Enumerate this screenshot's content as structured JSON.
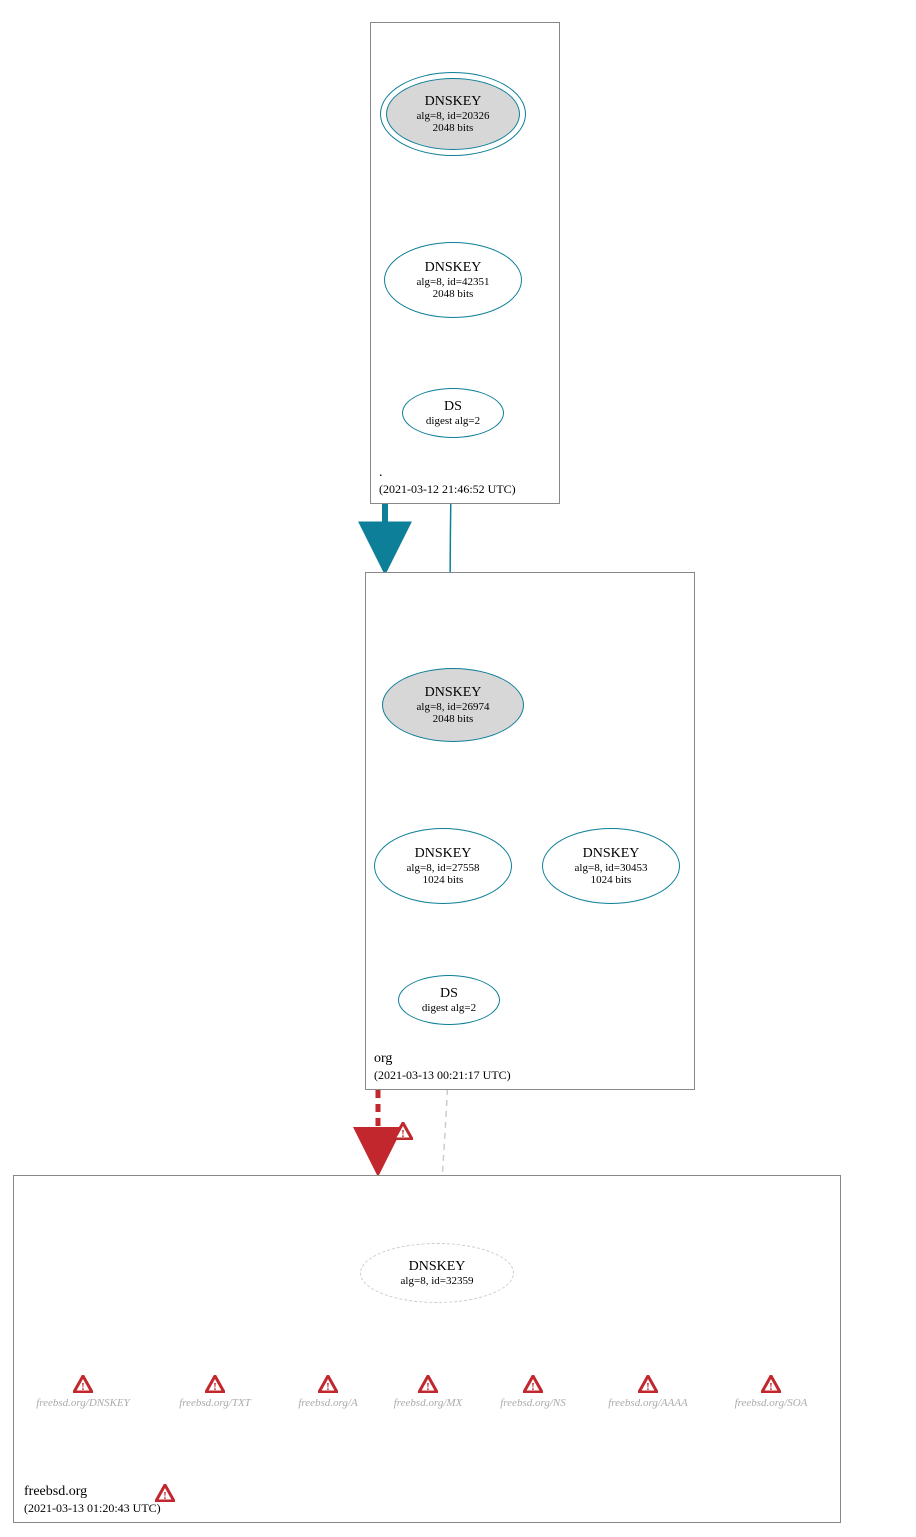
{
  "zones": {
    "root": {
      "label": ".",
      "timestamp": "(2021-03-12 21:46:52 UTC)"
    },
    "org": {
      "label": "org",
      "timestamp": "(2021-03-13 00:21:17 UTC)"
    },
    "freebsd": {
      "label": "freebsd.org",
      "timestamp": "(2021-03-13 01:20:43 UTC)"
    }
  },
  "nodes": {
    "root_ksk": {
      "title": "DNSKEY",
      "sub1": "alg=8, id=20326",
      "sub2": "2048 bits"
    },
    "root_zsk": {
      "title": "DNSKEY",
      "sub1": "alg=8, id=42351",
      "sub2": "2048 bits"
    },
    "root_ds": {
      "title": "DS",
      "sub1": "digest alg=2"
    },
    "org_ksk": {
      "title": "DNSKEY",
      "sub1": "alg=8, id=26974",
      "sub2": "2048 bits"
    },
    "org_zsk1": {
      "title": "DNSKEY",
      "sub1": "alg=8, id=27558",
      "sub2": "1024 bits"
    },
    "org_zsk2": {
      "title": "DNSKEY",
      "sub1": "alg=8, id=30453",
      "sub2": "1024 bits"
    },
    "org_ds": {
      "title": "DS",
      "sub1": "digest alg=2"
    },
    "fb_key": {
      "title": "DNSKEY",
      "sub1": "alg=8, id=32359"
    }
  },
  "records": {
    "dnskey": "freebsd.org/DNSKEY",
    "txt": "freebsd.org/TXT",
    "a": "freebsd.org/A",
    "mx": "freebsd.org/MX",
    "ns": "freebsd.org/NS",
    "aaaa": "freebsd.org/AAAA",
    "soa": "freebsd.org/SOA"
  },
  "colors": {
    "teal": "#0d7f99",
    "red": "#c1272d",
    "grey": "#cccccc"
  }
}
